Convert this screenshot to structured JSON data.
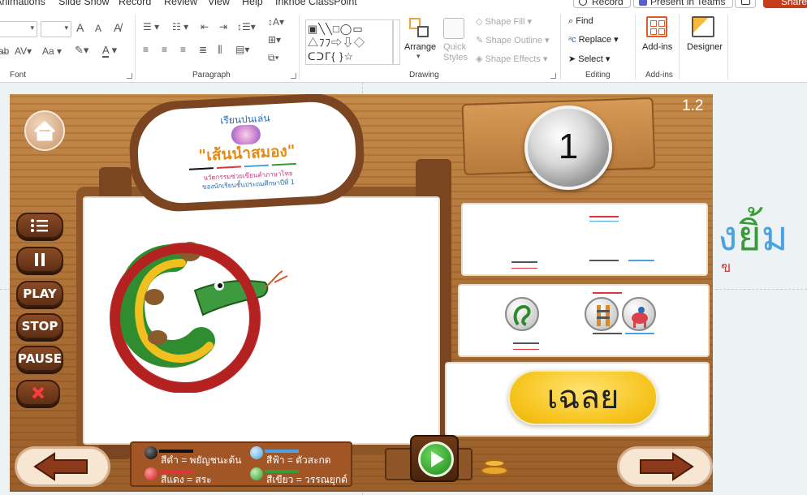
{
  "ribbon": {
    "tabs": [
      "Animations",
      "Slide Show",
      "Record",
      "Review",
      "View",
      "Help",
      "Inknoe ClassPoint"
    ],
    "record_button": "Record",
    "teams_button": "Present in Teams",
    "share_button": "Share",
    "groups": {
      "font": "Font",
      "paragraph": "Paragraph",
      "drawing": "Drawing",
      "editing": "Editing",
      "addins": "Add-ins"
    },
    "font_size_up": "A",
    "font_size_down": "A",
    "font_case": "Aa",
    "arrange_label": "Arrange",
    "quick_styles_label": "Quick Styles",
    "shape_fill": "Shape Fill",
    "shape_outline": "Shape Outline",
    "shape_effects": "Shape Effects",
    "find": "Find",
    "replace": "Replace",
    "select": "Select",
    "addins_button": "Add-ins",
    "designer_button": "Designer"
  },
  "slide": {
    "number_badge": "1.2",
    "logo": {
      "top_text": "เรียนปนเล่น",
      "title": "\"เส้นนำสมอง\"",
      "subtitle_line1": "นวัตกรรมช่วยเขียนคำภาษาไทย",
      "subtitle_line2": "ของนักเรียนชั้นประถมศึกษาปีที่ 1"
    },
    "counter": "1",
    "side_buttons": {
      "play": "PLAY",
      "stop": "STOP",
      "pause": "PAUSE"
    },
    "answer_button": "เฉลย",
    "legend": {
      "black": "สีดำ  =  พยัญชนะต้น",
      "red": "สีแดง  =  สระ",
      "blue": "สีฟ้า  =  ตัวสะกด",
      "green": "สีเขียว  =  วรรณยุกต์"
    },
    "word_chars": {
      "ngo": "ง",
      "yo": "ยิ้",
      "mo": "ม",
      "khor": "ข"
    }
  },
  "colors": {
    "consonant": "#111111",
    "vowel": "#e0343a",
    "final": "#4aa3e0",
    "tone": "#3a9a38",
    "share": "#c43e1c"
  }
}
